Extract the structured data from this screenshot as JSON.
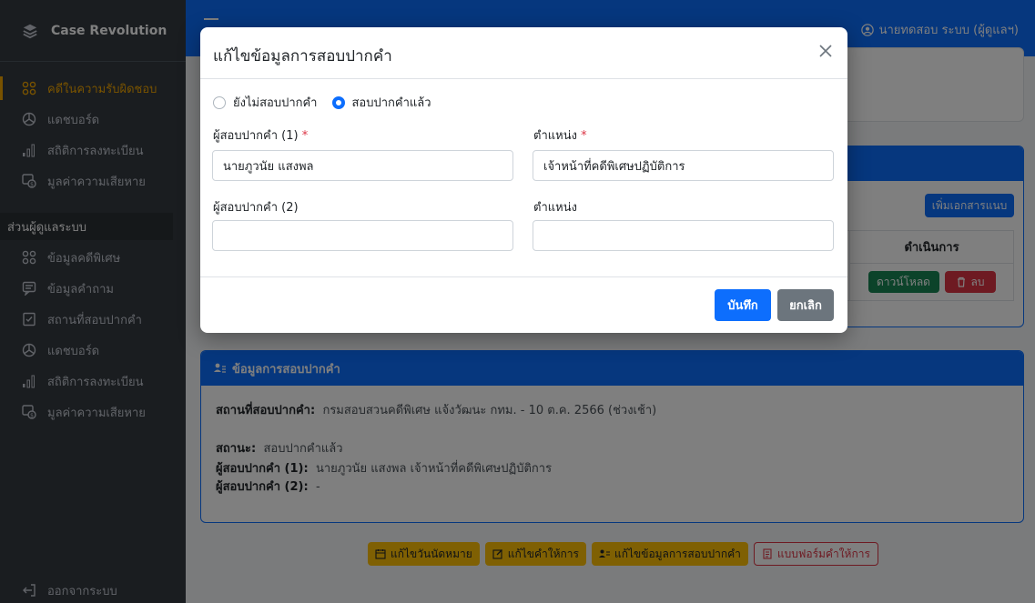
{
  "app": {
    "brand": "Case Revolution"
  },
  "sidebar": {
    "items": [
      {
        "label": "คดีในความรับผิดชอบ",
        "icon": "cluster-icon",
        "active": true
      },
      {
        "label": "แดชบอร์ด",
        "icon": "dashboard-icon"
      },
      {
        "label": "สถิติการลงทะเบียน",
        "icon": "bar-chart-icon"
      },
      {
        "label": "มูลค่าความเสียหาย",
        "icon": "money-icon"
      }
    ],
    "section_admin": "ส่วนผู้ดูแลระบบ",
    "admin_items": [
      {
        "label": "ข้อมูลคดีพิเศษ",
        "icon": "cluster-icon"
      },
      {
        "label": "ข้อมูลคำถาม",
        "icon": "question-icon"
      },
      {
        "label": "สถานที่สอบปากคำ",
        "icon": "checklist-icon"
      },
      {
        "label": "แดชบอร์ด",
        "icon": "dashboard-icon"
      },
      {
        "label": "สถิติการลงทะเบียน",
        "icon": "bar-chart-icon"
      },
      {
        "label": "มูลค่าความเสียหาย",
        "icon": "money-icon"
      }
    ],
    "logout": "ออกจากระบบ"
  },
  "header": {
    "user": "นายทดสอบ ระบบ (ผู้ดูแลฯ)"
  },
  "documents": {
    "add_button": "เพิ่มเอกสารแนบ",
    "action_header": "ดำเนินการ",
    "download_button": "ดาวน์โหลด",
    "delete_button": "ลบ"
  },
  "interview": {
    "title": "ข้อมูลการสอบปากคำ",
    "location_label": "สถานที่สอบปากคำ:",
    "location_value": "กรมสอบสวนคดีพิเศษ แจ้งวัฒนะ กทม. - 10 ต.ค. 2566 (ช่วงเช้า)",
    "status_label": "สถานะ:",
    "status_value": "สอบปากคำแล้ว",
    "interviewer1_label": "ผู้สอบปากคำ (1):",
    "interviewer1_value": "นายภูวนัย แสงพล เจ้าหน้าที่คดีพิเศษปฏิบัติการ",
    "interviewer2_label": "ผู้สอบปากคำ (2):",
    "interviewer2_value": "-"
  },
  "actions": {
    "edit_appointment": "แก้ไขวันนัดหมาย",
    "edit_testimony": "แก้ไขคำให้การ",
    "edit_interview": "แก้ไขข้อมูลการสอบปากคำ",
    "testimony_form": "แบบฟอร์มคำให้การ"
  },
  "modal": {
    "title": "แก้ไขข้อมูลการสอบปากคำ",
    "radio_not_done": "ยังไม่สอบปากคำ",
    "radio_done": "สอบปากคำแล้ว",
    "selected": "done",
    "interviewer1_label": "ผู้สอบปากคำ (1)",
    "interviewer1_value": "นายภูวนัย แสงพล",
    "position1_label": "ตำแหน่ง",
    "position1_value": "เจ้าหน้าที่คดีพิเศษปฏิบัติการ",
    "interviewer2_label": "ผู้สอบปากคำ (2)",
    "interviewer2_value": "",
    "position2_label": "ตำแหน่ง",
    "position2_value": "",
    "required_mark": "*",
    "save_button": "บันทึก",
    "cancel_button": "ยกเลิก"
  },
  "colors": {
    "primary": "#0d6efd",
    "sidebar_bg": "#343a40",
    "active": "#f0a500",
    "warning": "#ffc107",
    "danger": "#dc3545",
    "success": "#198754"
  }
}
